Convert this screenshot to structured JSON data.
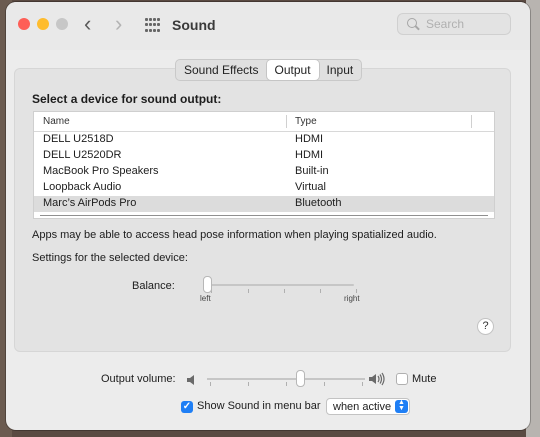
{
  "window": {
    "title": "Sound"
  },
  "search": {
    "placeholder": "Search"
  },
  "tabs": [
    {
      "label": "Sound Effects",
      "active": false
    },
    {
      "label": "Output",
      "active": true
    },
    {
      "label": "Input",
      "active": false
    }
  ],
  "output": {
    "heading": "Select a device for sound output:",
    "columns": {
      "name": "Name",
      "type": "Type"
    },
    "devices": [
      {
        "name": "DELL U2518D",
        "type": "HDMI",
        "selected": false
      },
      {
        "name": "DELL U2520DR",
        "type": "HDMI",
        "selected": false
      },
      {
        "name": "MacBook Pro Speakers",
        "type": "Built-in",
        "selected": false
      },
      {
        "name": "Loopback Audio",
        "type": "Virtual",
        "selected": false
      },
      {
        "name": "Marc’s AirPods Pro",
        "type": "Bluetooth",
        "selected": true
      }
    ],
    "info": "Apps may be able to access head pose information when playing spatialized audio.",
    "settings_label": "Settings for the selected device:",
    "balance": {
      "label": "Balance:",
      "left": "left",
      "right": "right",
      "value": 0.0
    },
    "help": "?"
  },
  "volume": {
    "label": "Output volume:",
    "value": 0.6,
    "mute_label": "Mute",
    "muted": false
  },
  "menubar": {
    "label": "Show Sound in menu bar",
    "checked": true,
    "mark": "✓",
    "option": "when active",
    "arrows": "▲▼"
  },
  "colors": {
    "accent": "#1f7ff5",
    "close": "#fe5f57",
    "minimize": "#febc2e"
  }
}
